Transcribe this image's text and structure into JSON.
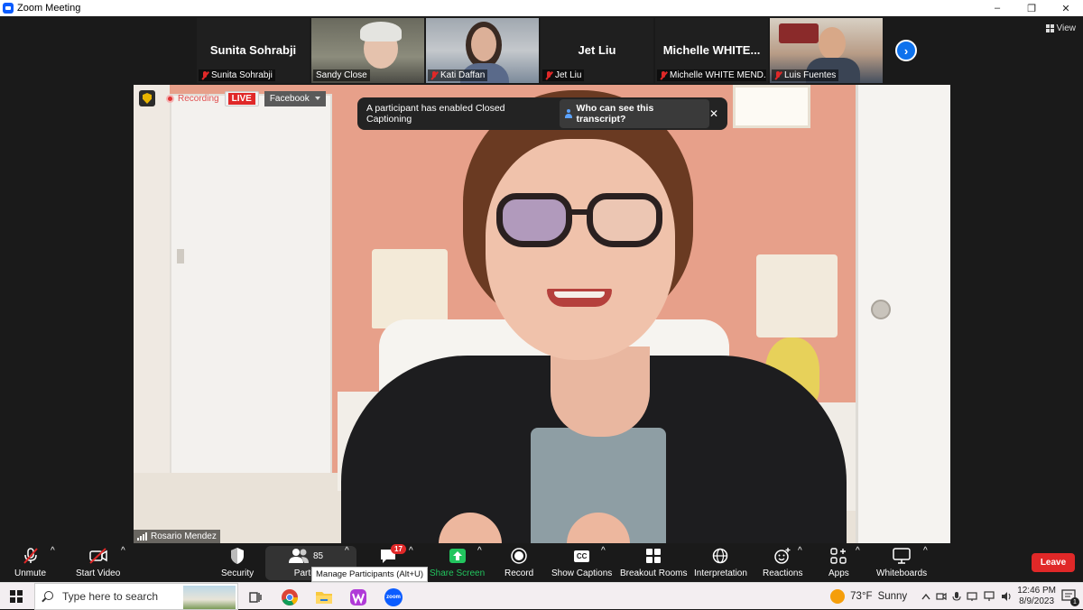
{
  "window": {
    "title": "Zoom Meeting",
    "controls": [
      "–",
      "❐",
      "✕"
    ]
  },
  "gallery": {
    "tiles": [
      {
        "display_text": "Sunita Sohrabji",
        "label": "Sunita Sohrabji",
        "has_video": false
      },
      {
        "display_text": "",
        "label": "Sandy Close",
        "has_video": true
      },
      {
        "display_text": "",
        "label": "Kati Daffan",
        "has_video": true
      },
      {
        "display_text": "Jet Liu",
        "label": "Jet Liu",
        "has_video": false
      },
      {
        "display_text": "Michelle  WHITE...",
        "label": "Michelle WHITE MEND...",
        "has_video": false
      },
      {
        "display_text": "",
        "label": "Luis Fuentes",
        "has_video": true
      }
    ],
    "next_glyph": "›",
    "view_label": "View"
  },
  "stage": {
    "recording_label": "Recording",
    "live_label": "LIVE",
    "stream_target": "Facebook",
    "cc_banner": {
      "message": "A participant has enabled Closed Captioning",
      "link": "Who can see this transcript?",
      "close": "✕"
    },
    "speaker_name": "Rosario Mendez"
  },
  "toolbar": {
    "unmute": "Unmute",
    "start_video": "Start Video",
    "security": "Security",
    "participants": "Partic",
    "participants_count": "85",
    "participants_tooltip": "Manage Participants (Alt+U)",
    "chat_badge": "17",
    "share_screen": "Share Screen",
    "record": "Record",
    "show_captions": "Show Captions",
    "cc_icon": "CC",
    "breakout_rooms": "Breakout Rooms",
    "interpretation": "Interpretation",
    "reactions": "Reactions",
    "apps": "Apps",
    "whiteboards": "Whiteboards",
    "leave": "Leave",
    "caret": "^"
  },
  "taskbar": {
    "search_placeholder": "Type here to search",
    "apps": [
      "chrome-icon",
      "file-explorer-icon",
      "wps-icon",
      "zoom-icon"
    ],
    "zoom_app_label": "zoom",
    "weather_temp": "73°F",
    "weather_desc": "Sunny",
    "time": "12:46 PM",
    "date": "8/9/2023",
    "notification_count": "1"
  },
  "colors": {
    "accent": "#0e72ed",
    "leave": "#e02828",
    "share": "#22c55e",
    "live": "#e02828"
  }
}
